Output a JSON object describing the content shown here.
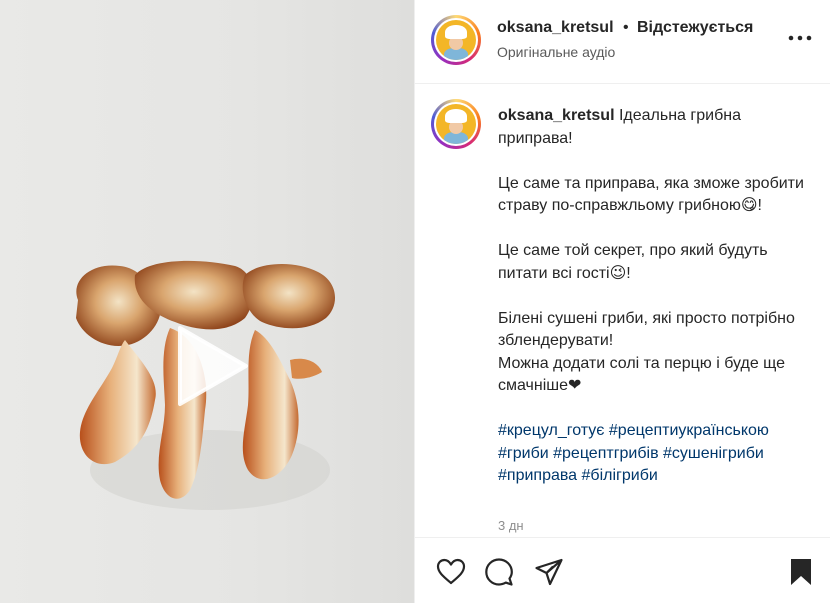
{
  "post": {
    "username": "oksana_kretsul",
    "separator": "•",
    "follow_status": "Відстежується",
    "audio": "Оригінальне аудіо"
  },
  "caption": {
    "username": "oksana_kretsul",
    "line1": "Ідеальна грибна приправа!",
    "para2": "Це саме та приправа, яка зможе зробити страву по-справжльому грибною😋!",
    "para3": "Це саме той секрет, про який будуть питати всі гості😉!",
    "para4_line1": "Білені сушені гриби, які просто потрібно зблендерувати!",
    "para4_line2": "Можна додати солі та перцю і буде ще смачніше❤",
    "hashtags": "#крецул_готує #рецептиукраїнською #гриби #рецептгрибів #сушенігриби #приправа #білігриби"
  },
  "timestamp": "3 дн",
  "icons": {
    "more": "more-options-icon",
    "play": "play-icon",
    "like": "heart-icon",
    "comment": "comment-icon",
    "share": "share-icon",
    "save": "bookmark-icon"
  },
  "colors": {
    "text": "#262626",
    "secondary": "#8e8e8e",
    "hashtag": "#00376b",
    "divider": "#efefef"
  }
}
